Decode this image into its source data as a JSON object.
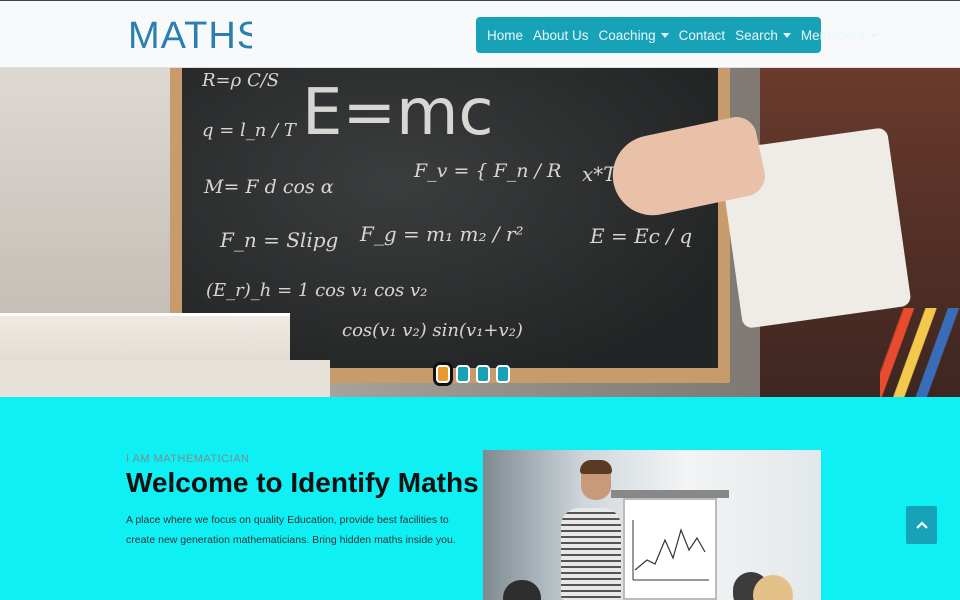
{
  "brand": {
    "logo_text": "MATHS"
  },
  "nav": {
    "items": [
      {
        "label": "Home",
        "dropdown": false
      },
      {
        "label": "About Us",
        "dropdown": false
      },
      {
        "label": "Coaching",
        "dropdown": true
      },
      {
        "label": "Contact",
        "dropdown": false
      },
      {
        "label": "Search",
        "dropdown": true
      },
      {
        "label": "Memebers",
        "dropdown": true
      }
    ]
  },
  "hero": {
    "chalk": [
      "E=mc",
      "R=ρ C/S",
      "q = l_n / T",
      "M= F d cos α",
      "F_v = { F_n / R",
      "x*T = 6",
      "F_n = Slipg",
      "F_g = m₁ m₂ / r²",
      "E = Ec / q",
      "(E_r)_h = 1 cos v₁ cos v₂",
      "cos(v₁ v₂) sin(v₁+v₂)"
    ],
    "carousel": {
      "count": 4,
      "active_index": 0
    }
  },
  "intro": {
    "eyebrow": "I AM MATHEMATICIAN",
    "title": "Welcome to Identify Maths",
    "description": "A place where we focus on quality Education, provide best facilities to create new generation mathematicians. Bring hidden maths inside you."
  },
  "scroll_top": {
    "icon": "chevron-up-icon"
  },
  "colors": {
    "accent": "#17a2b8",
    "section_bg": "#0ff0f5",
    "logo": "#2a7fb0"
  }
}
